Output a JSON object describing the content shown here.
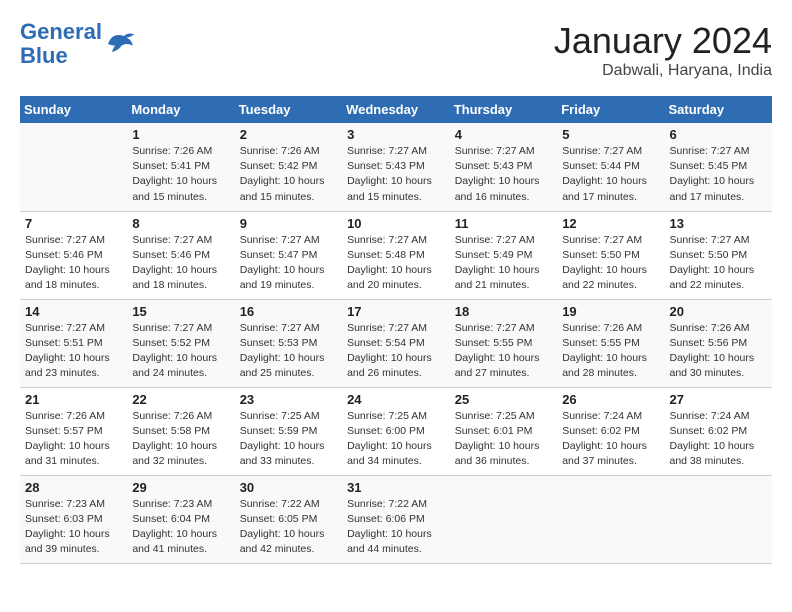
{
  "header": {
    "logo_line1": "General",
    "logo_line2": "Blue",
    "month": "January 2024",
    "location": "Dabwali, Haryana, India"
  },
  "days_of_week": [
    "Sunday",
    "Monday",
    "Tuesday",
    "Wednesday",
    "Thursday",
    "Friday",
    "Saturday"
  ],
  "weeks": [
    [
      {
        "day": "",
        "info": ""
      },
      {
        "day": "1",
        "info": "Sunrise: 7:26 AM\nSunset: 5:41 PM\nDaylight: 10 hours\nand 15 minutes."
      },
      {
        "day": "2",
        "info": "Sunrise: 7:26 AM\nSunset: 5:42 PM\nDaylight: 10 hours\nand 15 minutes."
      },
      {
        "day": "3",
        "info": "Sunrise: 7:27 AM\nSunset: 5:43 PM\nDaylight: 10 hours\nand 15 minutes."
      },
      {
        "day": "4",
        "info": "Sunrise: 7:27 AM\nSunset: 5:43 PM\nDaylight: 10 hours\nand 16 minutes."
      },
      {
        "day": "5",
        "info": "Sunrise: 7:27 AM\nSunset: 5:44 PM\nDaylight: 10 hours\nand 17 minutes."
      },
      {
        "day": "6",
        "info": "Sunrise: 7:27 AM\nSunset: 5:45 PM\nDaylight: 10 hours\nand 17 minutes."
      }
    ],
    [
      {
        "day": "7",
        "info": "Sunrise: 7:27 AM\nSunset: 5:46 PM\nDaylight: 10 hours\nand 18 minutes."
      },
      {
        "day": "8",
        "info": "Sunrise: 7:27 AM\nSunset: 5:46 PM\nDaylight: 10 hours\nand 18 minutes."
      },
      {
        "day": "9",
        "info": "Sunrise: 7:27 AM\nSunset: 5:47 PM\nDaylight: 10 hours\nand 19 minutes."
      },
      {
        "day": "10",
        "info": "Sunrise: 7:27 AM\nSunset: 5:48 PM\nDaylight: 10 hours\nand 20 minutes."
      },
      {
        "day": "11",
        "info": "Sunrise: 7:27 AM\nSunset: 5:49 PM\nDaylight: 10 hours\nand 21 minutes."
      },
      {
        "day": "12",
        "info": "Sunrise: 7:27 AM\nSunset: 5:50 PM\nDaylight: 10 hours\nand 22 minutes."
      },
      {
        "day": "13",
        "info": "Sunrise: 7:27 AM\nSunset: 5:50 PM\nDaylight: 10 hours\nand 22 minutes."
      }
    ],
    [
      {
        "day": "14",
        "info": "Sunrise: 7:27 AM\nSunset: 5:51 PM\nDaylight: 10 hours\nand 23 minutes."
      },
      {
        "day": "15",
        "info": "Sunrise: 7:27 AM\nSunset: 5:52 PM\nDaylight: 10 hours\nand 24 minutes."
      },
      {
        "day": "16",
        "info": "Sunrise: 7:27 AM\nSunset: 5:53 PM\nDaylight: 10 hours\nand 25 minutes."
      },
      {
        "day": "17",
        "info": "Sunrise: 7:27 AM\nSunset: 5:54 PM\nDaylight: 10 hours\nand 26 minutes."
      },
      {
        "day": "18",
        "info": "Sunrise: 7:27 AM\nSunset: 5:55 PM\nDaylight: 10 hours\nand 27 minutes."
      },
      {
        "day": "19",
        "info": "Sunrise: 7:26 AM\nSunset: 5:55 PM\nDaylight: 10 hours\nand 28 minutes."
      },
      {
        "day": "20",
        "info": "Sunrise: 7:26 AM\nSunset: 5:56 PM\nDaylight: 10 hours\nand 30 minutes."
      }
    ],
    [
      {
        "day": "21",
        "info": "Sunrise: 7:26 AM\nSunset: 5:57 PM\nDaylight: 10 hours\nand 31 minutes."
      },
      {
        "day": "22",
        "info": "Sunrise: 7:26 AM\nSunset: 5:58 PM\nDaylight: 10 hours\nand 32 minutes."
      },
      {
        "day": "23",
        "info": "Sunrise: 7:25 AM\nSunset: 5:59 PM\nDaylight: 10 hours\nand 33 minutes."
      },
      {
        "day": "24",
        "info": "Sunrise: 7:25 AM\nSunset: 6:00 PM\nDaylight: 10 hours\nand 34 minutes."
      },
      {
        "day": "25",
        "info": "Sunrise: 7:25 AM\nSunset: 6:01 PM\nDaylight: 10 hours\nand 36 minutes."
      },
      {
        "day": "26",
        "info": "Sunrise: 7:24 AM\nSunset: 6:02 PM\nDaylight: 10 hours\nand 37 minutes."
      },
      {
        "day": "27",
        "info": "Sunrise: 7:24 AM\nSunset: 6:02 PM\nDaylight: 10 hours\nand 38 minutes."
      }
    ],
    [
      {
        "day": "28",
        "info": "Sunrise: 7:23 AM\nSunset: 6:03 PM\nDaylight: 10 hours\nand 39 minutes."
      },
      {
        "day": "29",
        "info": "Sunrise: 7:23 AM\nSunset: 6:04 PM\nDaylight: 10 hours\nand 41 minutes."
      },
      {
        "day": "30",
        "info": "Sunrise: 7:22 AM\nSunset: 6:05 PM\nDaylight: 10 hours\nand 42 minutes."
      },
      {
        "day": "31",
        "info": "Sunrise: 7:22 AM\nSunset: 6:06 PM\nDaylight: 10 hours\nand 44 minutes."
      },
      {
        "day": "",
        "info": ""
      },
      {
        "day": "",
        "info": ""
      },
      {
        "day": "",
        "info": ""
      }
    ]
  ]
}
